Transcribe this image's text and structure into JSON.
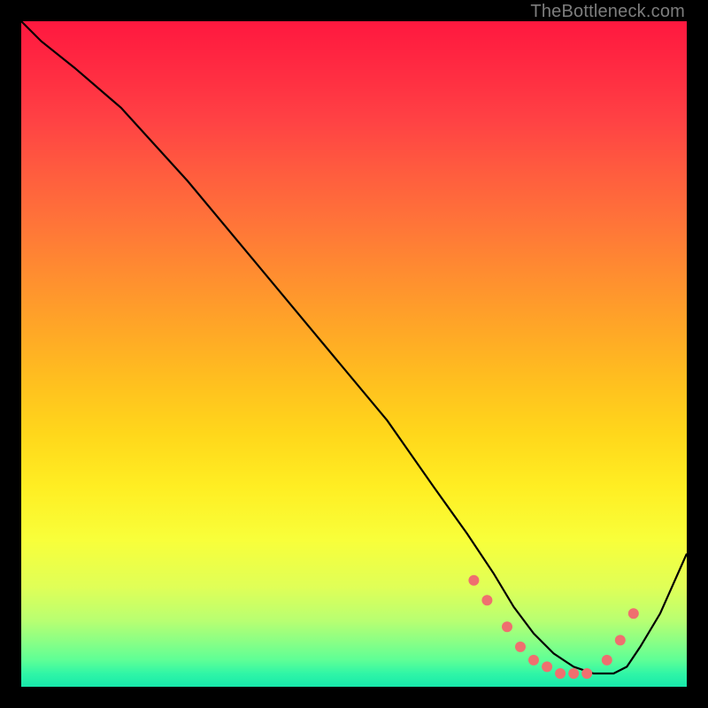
{
  "watermark": "TheBottleneck.com",
  "chart_data": {
    "type": "line",
    "title": "",
    "xlabel": "",
    "ylabel": "",
    "xlim": [
      0,
      100
    ],
    "ylim": [
      0,
      100
    ],
    "series": [
      {
        "name": "curve",
        "x": [
          0,
          3,
          8,
          15,
          25,
          35,
          45,
          55,
          62,
          67,
          71,
          74,
          77,
          80,
          83,
          86,
          89,
          91,
          93,
          96,
          100
        ],
        "y": [
          100,
          97,
          93,
          87,
          76,
          64,
          52,
          40,
          30,
          23,
          17,
          12,
          8,
          5,
          3,
          2,
          2,
          3,
          6,
          11,
          20
        ]
      }
    ],
    "markers": {
      "name": "dots",
      "color": "#ef6f6f",
      "x": [
        68,
        70,
        73,
        75,
        77,
        79,
        81,
        83,
        85,
        88,
        90,
        92
      ],
      "y": [
        16,
        13,
        9,
        6,
        4,
        3,
        2,
        2,
        2,
        4,
        7,
        11
      ]
    },
    "gradient_stops": [
      {
        "pos": 0,
        "color": "#ff183f"
      },
      {
        "pos": 8,
        "color": "#ff2d42"
      },
      {
        "pos": 15,
        "color": "#ff4244"
      },
      {
        "pos": 22,
        "color": "#ff5a3f"
      },
      {
        "pos": 30,
        "color": "#ff7339"
      },
      {
        "pos": 38,
        "color": "#ff8d30"
      },
      {
        "pos": 46,
        "color": "#ffa627"
      },
      {
        "pos": 54,
        "color": "#ffbf1f"
      },
      {
        "pos": 62,
        "color": "#ffd71b"
      },
      {
        "pos": 70,
        "color": "#ffee23"
      },
      {
        "pos": 78,
        "color": "#f8ff3a"
      },
      {
        "pos": 85,
        "color": "#e0ff57"
      },
      {
        "pos": 90,
        "color": "#b9ff71"
      },
      {
        "pos": 93,
        "color": "#8dff84"
      },
      {
        "pos": 96,
        "color": "#5eff96"
      },
      {
        "pos": 98,
        "color": "#30f6a6"
      },
      {
        "pos": 100,
        "color": "#17e8ab"
      }
    ]
  }
}
